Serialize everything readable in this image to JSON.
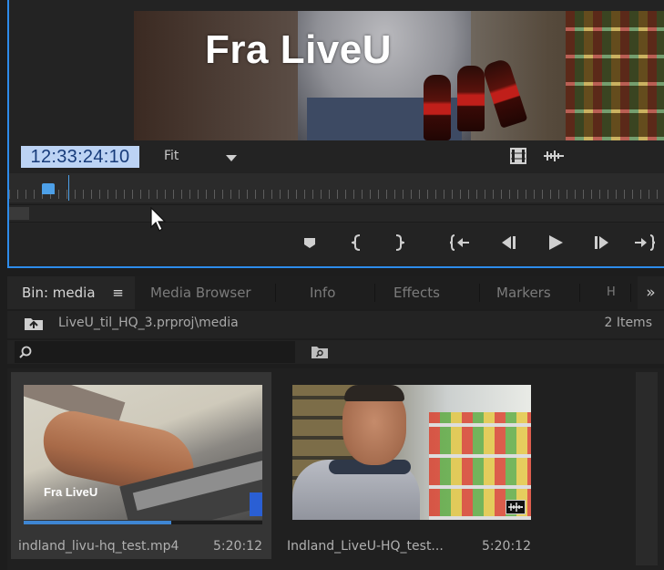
{
  "monitor": {
    "video_caption": "Fra LiveU",
    "timecode": "12:33:24:10",
    "fit_label": "Fit"
  },
  "bin_panel": {
    "tabs": [
      {
        "label": "Bin: media",
        "active": true
      },
      {
        "label": "Media Browser"
      },
      {
        "label": "Info"
      },
      {
        "label": "Effects"
      },
      {
        "label": "Markers"
      },
      {
        "label": "H"
      }
    ],
    "menu_glyph": "≡",
    "overflow_glyph": "»",
    "path": "LiveU_til_HQ_3.prproj\\media",
    "item_count": "2 Items",
    "search_value": "",
    "clips": [
      {
        "name": "indland_livu-hq_test.mp4",
        "duration": "5:20:12",
        "thumb_caption": "Fra LiveU",
        "progress": 0.62,
        "selected": true
      },
      {
        "name": "Indland_LiveU-HQ_test...",
        "duration": "5:20:12",
        "selected": false
      }
    ]
  },
  "colors": {
    "accent": "#2d8ceb",
    "timecode_bg": "#bcd3f4",
    "timecode_fg": "#173b7a",
    "panel_bg": "#1d1d1d"
  }
}
